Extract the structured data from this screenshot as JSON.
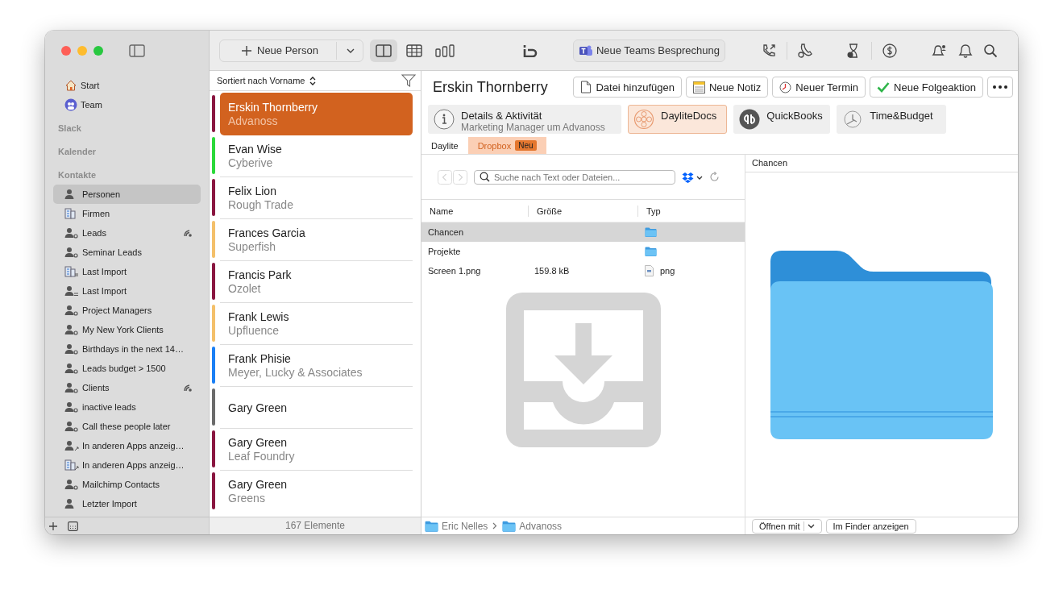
{
  "toolbar": {
    "new_button": "Neue Person",
    "view_modes": [
      {
        "kind": "split",
        "selected": true
      },
      {
        "kind": "table",
        "selected": false
      },
      {
        "kind": "columns",
        "selected": false
      }
    ],
    "teams_button": "Neue Teams Besprechung"
  },
  "sidebar": {
    "top_items": [
      {
        "label": "Start",
        "kind": "home",
        "selected": false
      },
      {
        "label": "Team",
        "kind": "team",
        "selected": false
      }
    ],
    "sections": [
      {
        "title": "Slack"
      },
      {
        "title": "Kalender"
      },
      {
        "title": "Kontakte",
        "items": [
          {
            "label": "Personen",
            "kind": "person",
            "selected": true,
            "shared": false
          },
          {
            "label": "Firmen",
            "kind": "company",
            "selected": false,
            "shared": false
          },
          {
            "label": "Leads",
            "kind": "smart",
            "selected": false,
            "shared": true
          },
          {
            "label": "Seminar Leads",
            "kind": "smart",
            "selected": false,
            "shared": false
          },
          {
            "label": "Last Import",
            "kind": "company-list",
            "selected": false,
            "shared": false
          },
          {
            "label": "Last Import",
            "kind": "person-list",
            "selected": false,
            "shared": false
          },
          {
            "label": "Project Managers",
            "kind": "smart",
            "selected": false,
            "shared": false
          },
          {
            "label": "My New York Clients",
            "kind": "smart",
            "selected": false,
            "shared": false
          },
          {
            "label": "Birthdays in the next 14…",
            "kind": "smart",
            "selected": false,
            "shared": false
          },
          {
            "label": "Leads budget > 1500",
            "kind": "smart",
            "selected": false,
            "shared": false
          },
          {
            "label": "Clients",
            "kind": "smart",
            "selected": false,
            "shared": true
          },
          {
            "label": "inactive leads",
            "kind": "smart",
            "selected": false,
            "shared": false
          },
          {
            "label": "Call these people later",
            "kind": "smart",
            "selected": false,
            "shared": false
          },
          {
            "label": "In anderen Apps anzeig…",
            "kind": "person-link",
            "selected": false,
            "shared": false
          },
          {
            "label": "In anderen Apps anzeig…",
            "kind": "company-link",
            "selected": false,
            "shared": false
          },
          {
            "label": "Mailchimp Contacts",
            "kind": "smart",
            "selected": false,
            "shared": false
          },
          {
            "label": "Letzter Import",
            "kind": "person",
            "selected": false,
            "shared": false
          }
        ]
      }
    ]
  },
  "list": {
    "sort_label": "Sortiert nach Vorname",
    "contacts": [
      {
        "name": "Erskin Thornberry",
        "company": "Advanoss",
        "color": "#8a1640",
        "selected": true
      },
      {
        "name": "Evan Wise",
        "company": "Cyberive",
        "color": "#2bd93a",
        "selected": false
      },
      {
        "name": "Felix Lion",
        "company": "Rough Trade",
        "color": "#8a1640",
        "selected": false
      },
      {
        "name": "Frances Garcia",
        "company": "Superfish",
        "color": "#f4c06a",
        "selected": false
      },
      {
        "name": "Francis Park",
        "company": "Ozolet",
        "color": "#8a1640",
        "selected": false
      },
      {
        "name": "Frank Lewis",
        "company": "Upfluence",
        "color": "#f4c06a",
        "selected": false
      },
      {
        "name": "Frank Phisie",
        "company": "Meyer, Lucky & Associates",
        "color": "#1a7ff5",
        "selected": false
      },
      {
        "name": "Gary Green",
        "color": "#6b6b6b",
        "selected": false
      },
      {
        "name": "Gary Green",
        "company": "Leaf Foundry",
        "color": "#8a1640",
        "selected": false
      },
      {
        "name": "Gary Green",
        "company": "Greens",
        "color": "#8a1640",
        "selected": false
      }
    ],
    "footer": "167 Elemente"
  },
  "detail": {
    "title": "Erskin Thornberry",
    "actions": [
      {
        "label": "Datei hinzufügen",
        "kind": "file"
      },
      {
        "label": "Neue Notiz",
        "kind": "note"
      },
      {
        "label": "Neuer Termin",
        "kind": "clock"
      },
      {
        "label": "Neue Folgeaktion",
        "kind": "check"
      }
    ],
    "app_tabs": [
      {
        "label": "Details & Aktivität",
        "subtitle": "Marketing Manager um Advanoss",
        "kind": "info",
        "selected": false
      },
      {
        "label": "DayliteDocs",
        "kind": "docs",
        "selected": true
      },
      {
        "label": "QuickBooks",
        "kind": "qb",
        "selected": false
      },
      {
        "label": "Time&Budget",
        "kind": "time",
        "selected": false
      }
    ],
    "sub_tabs": [
      {
        "label": "Daylite",
        "selected": false
      },
      {
        "label": "Dropbox",
        "badge": "Neu",
        "selected": true
      }
    ],
    "browser": {
      "search_placeholder": "Suche nach Text oder Dateien...",
      "columns": [
        "Name",
        "Größe",
        "Typ"
      ],
      "rows": [
        {
          "name": "Chancen",
          "kind": "folder",
          "selected": true
        },
        {
          "name": "Projekte",
          "kind": "folder",
          "selected": false
        },
        {
          "name": "Screen 1.png",
          "size": "159.8 kB",
          "type": "png",
          "kind": "file",
          "selected": false
        }
      ],
      "path": [
        "Eric Nelles",
        "Advanoss"
      ]
    },
    "preview": {
      "title": "Chancen",
      "open_with": "Öffnen mit",
      "finder_button": "Im Finder anzeigen"
    }
  }
}
